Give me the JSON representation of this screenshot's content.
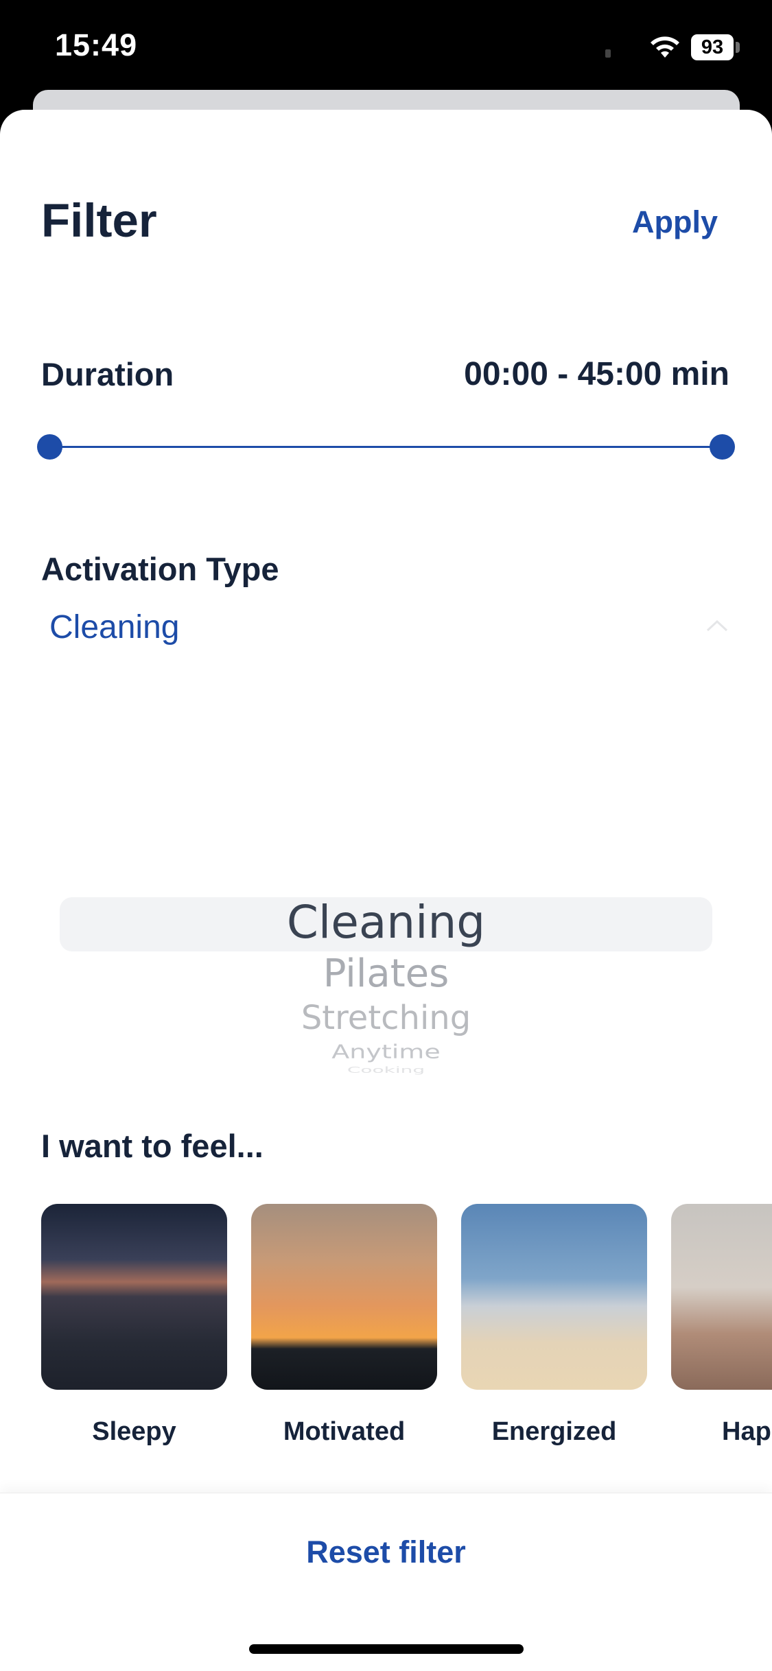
{
  "status_bar": {
    "time": "15:49",
    "battery": "93"
  },
  "header": {
    "title": "Filter",
    "apply_label": "Apply"
  },
  "duration": {
    "label": "Duration",
    "value": "00:00 - 45:00 min",
    "range_fraction": [
      0,
      1
    ]
  },
  "activation_type": {
    "label": "Activation Type",
    "selected": "Cleaning",
    "picker_options": [
      "Cleaning",
      "Pilates",
      "Stretching",
      "Anytime",
      "Cooking"
    ]
  },
  "feel": {
    "label": "I want to feel...",
    "moods": [
      {
        "label": "Sleepy"
      },
      {
        "label": "Motivated"
      },
      {
        "label": "Energized"
      },
      {
        "label": "Hap"
      }
    ]
  },
  "footer": {
    "reset_label": "Reset filter"
  },
  "colors": {
    "accent": "#1d4ca8",
    "text": "#16233a"
  }
}
